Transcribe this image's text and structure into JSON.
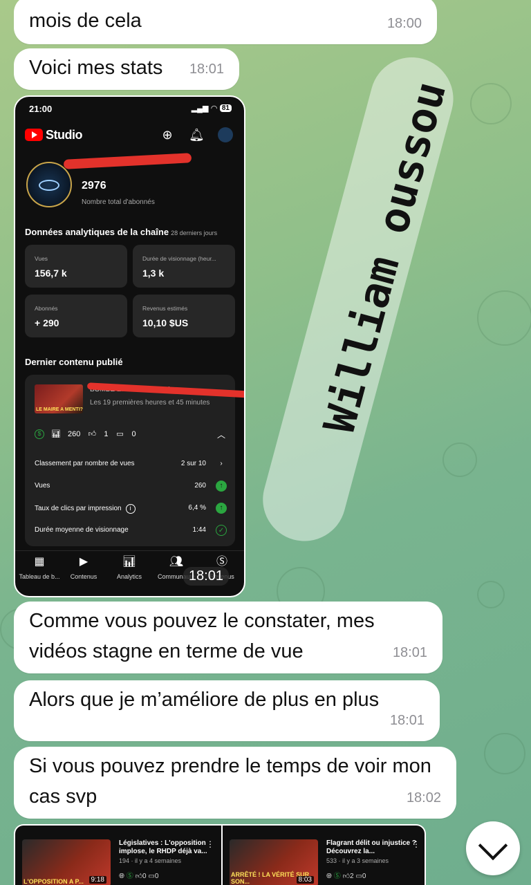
{
  "messages": [
    {
      "text": "mois de cela",
      "time": "18:00"
    },
    {
      "text": "Voici mes stats",
      "time": "18:01"
    },
    {
      "text": "Comme vous pouvez le constater, mes vidéos stagne en terme de vue",
      "time": "18:01"
    },
    {
      "text": "Alors que je m’améliore de plus en plus",
      "time": "18:01"
    },
    {
      "text": "Si vous pouvez prendre le temps de voir mon cas svp",
      "time": "18:02"
    }
  ],
  "screenshot": {
    "time_sent": "18:01",
    "status_bar": {
      "time": "21:00",
      "battery": "81"
    },
    "app_name": "Studio",
    "subscribers": {
      "value": "2976",
      "label": "Nombre total d'abonnés"
    },
    "analytics": {
      "title": "Données analytiques de la chaîne",
      "period": "28 derniers jours",
      "cards": [
        {
          "label": "Vues",
          "value": "156,7 k"
        },
        {
          "label": "Durée de visionnage (heur...",
          "value": "1,3 k"
        },
        {
          "label": "Abonnés",
          "value": "+ 290"
        },
        {
          "label": "Revenus estimés",
          "value": "10,10 $US"
        }
      ]
    },
    "latest": {
      "title": "Dernier contenu publié",
      "video_title": "BOMBE ÉLECTORALE : Le ...",
      "video_sub": "Les 19 premières heures et 45 minutes",
      "thumb_text": "LE MAIRE A MENTI?",
      "metrics": {
        "views": "260",
        "likes": "1",
        "comments": "0"
      },
      "rows": [
        {
          "label": "Classement par nombre de vues",
          "value": "2 sur 10"
        },
        {
          "label": "Vues",
          "value": "260"
        },
        {
          "label": "Taux de clics par impression",
          "value": "6,4 %"
        },
        {
          "label": "Durée moyenne de visionnage",
          "value": "1:44"
        }
      ]
    },
    "nav": [
      {
        "label": "Tableau de b...",
        "icon": "dashboard-icon"
      },
      {
        "label": "Contenus",
        "icon": "content-icon"
      },
      {
        "label": "Analytics",
        "icon": "analytics-icon"
      },
      {
        "label": "Communauté",
        "icon": "community-icon"
      },
      {
        "label": "Revenus",
        "icon": "earn-icon"
      }
    ]
  },
  "watermark": "William oussou",
  "videos": [
    {
      "title": "Législatives : L'opposition implose, le RHDP déjà va...",
      "meta": "194 · il y a 4 semaines",
      "duration": "9:18",
      "likes": "0",
      "comments": "0",
      "thumb_text": "L'OPPOSITION A P..."
    },
    {
      "title": "Flagrant délit ou injustice ? Découvrez la...",
      "meta": "533 · il y a 3 semaines",
      "duration": "8:03",
      "likes": "2",
      "comments": "0",
      "thumb_text": "ARRÊTÉ ! LA VÉRITÉ SUR SON..."
    }
  ]
}
